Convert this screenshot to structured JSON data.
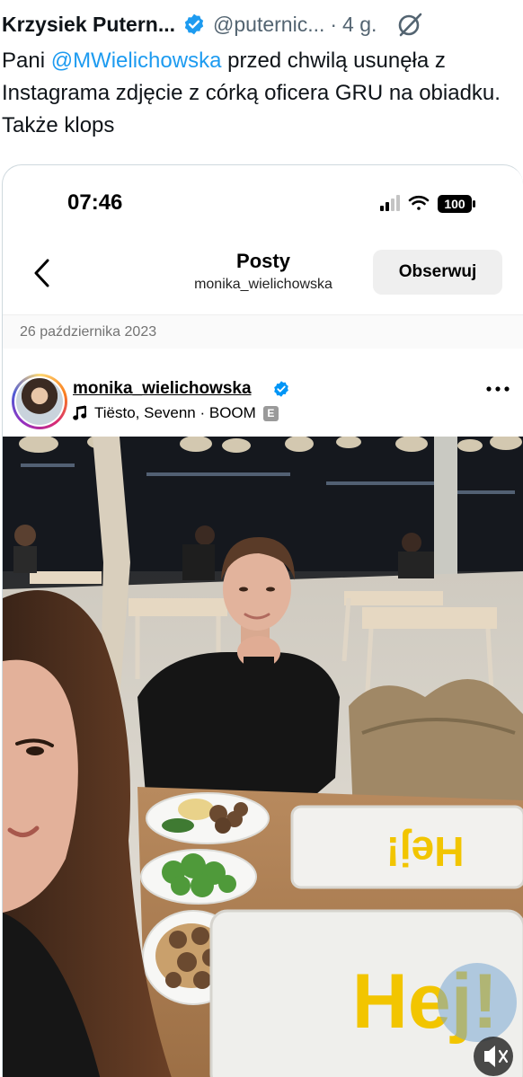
{
  "tweet": {
    "author_name": "Krzysiek Putern...",
    "handle": "@puternic...",
    "separator": "·",
    "time": "4 g.",
    "text_before": "Pani ",
    "mention": "@MWielichowska",
    "text_after": " przed chwilą usunęła z Instagrama zdjęcie z córką oficera GRU na obiadku. Także klops"
  },
  "phone": {
    "time": "07:46",
    "battery": "100"
  },
  "instagram": {
    "nav_title": "Posty",
    "nav_subtitle": "monika_wielichowska",
    "follow_label": "Obserwuj",
    "post_date": "26 października 2023",
    "username": "monika_wielichowska",
    "music": "Tiësto, Sevenn · BOOM",
    "explicit_badge": "E"
  },
  "photo": {
    "tray_text_top": "Hej!",
    "tray_text_bottom": "Hej!"
  },
  "icons": [
    "verified-badge-icon",
    "grok-icon",
    "signal-icon",
    "wifi-icon",
    "battery-icon",
    "back-arrow-icon",
    "music-note-icon",
    "more-options-icon",
    "mute-icon"
  ],
  "colors": {
    "accent": "#1d9bf0",
    "text": "#0f1419",
    "muted": "#536471",
    "ikea_yellow": "#f2c500"
  }
}
